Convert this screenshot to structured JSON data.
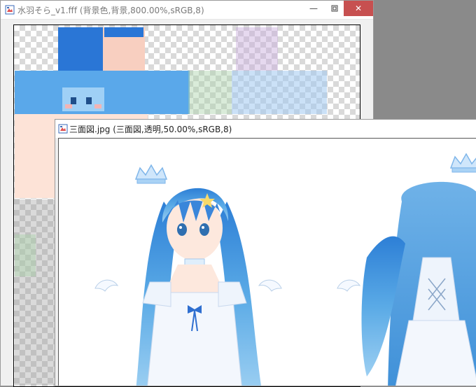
{
  "window1": {
    "title": "水羽そら_v1.fff (背景色,背景,800.00%,sRGB,8)",
    "minimize_glyph": "—",
    "maximize_glyph": "▫",
    "close_glyph": "✕"
  },
  "window2": {
    "title": "三面図.jpg (三面図,透明,50.00%,sRGB,8)"
  },
  "colors": {
    "hair_dark": "#1f6fd0",
    "hair_mid": "#4a9be0",
    "hair_light": "#8cc3ef",
    "skin": "#fde3d7",
    "close_button": "#c75050"
  }
}
